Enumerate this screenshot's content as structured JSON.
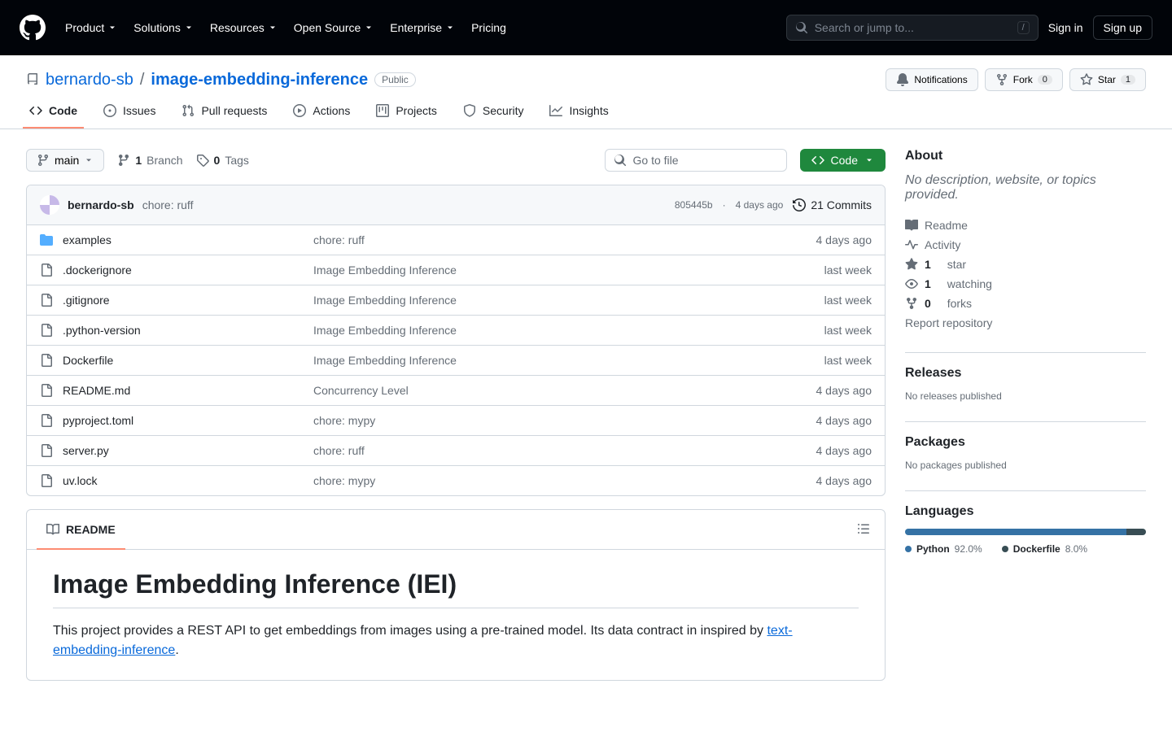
{
  "header": {
    "nav": [
      "Product",
      "Solutions",
      "Resources",
      "Open Source",
      "Enterprise",
      "Pricing"
    ],
    "search_placeholder": "Search or jump to...",
    "sign_in": "Sign in",
    "sign_up": "Sign up"
  },
  "repo": {
    "owner": "bernardo-sb",
    "name": "image-embedding-inference",
    "visibility": "Public",
    "notifications": "Notifications",
    "fork": "Fork",
    "fork_count": "0",
    "star": "Star",
    "star_count": "1"
  },
  "tabs": [
    "Code",
    "Issues",
    "Pull requests",
    "Actions",
    "Projects",
    "Security",
    "Insights"
  ],
  "branch": "main",
  "branches_count": "1",
  "branches_label": "Branch",
  "tags_count": "0",
  "tags_label": "Tags",
  "file_search_placeholder": "Go to file",
  "code_btn": "Code",
  "latest_commit": {
    "author": "bernardo-sb",
    "message": "chore: ruff",
    "sha": "805445b",
    "time": "4 days ago",
    "commits_count": "21 Commits"
  },
  "files": [
    {
      "type": "dir",
      "name": "examples",
      "msg": "chore: ruff",
      "time": "4 days ago"
    },
    {
      "type": "file",
      "name": ".dockerignore",
      "msg": "Image Embedding Inference",
      "time": "last week"
    },
    {
      "type": "file",
      "name": ".gitignore",
      "msg": "Image Embedding Inference",
      "time": "last week"
    },
    {
      "type": "file",
      "name": ".python-version",
      "msg": "Image Embedding Inference",
      "time": "last week"
    },
    {
      "type": "file",
      "name": "Dockerfile",
      "msg": "Image Embedding Inference",
      "time": "last week"
    },
    {
      "type": "file",
      "name": "README.md",
      "msg": "Concurrency Level",
      "time": "4 days ago"
    },
    {
      "type": "file",
      "name": "pyproject.toml",
      "msg": "chore: mypy",
      "time": "4 days ago"
    },
    {
      "type": "file",
      "name": "server.py",
      "msg": "chore: ruff",
      "time": "4 days ago"
    },
    {
      "type": "file",
      "name": "uv.lock",
      "msg": "chore: mypy",
      "time": "4 days ago"
    }
  ],
  "readme": {
    "tab": "README",
    "h1": "Image Embedding Inference (IEI)",
    "p1_before": "This project provides a REST API to get embeddings from images using a pre-trained model. Its data contract in inspired by ",
    "p1_link": "text-embedding-inference",
    "p1_after": "."
  },
  "about": {
    "title": "About",
    "desc": "No description, website, or topics provided.",
    "readme": "Readme",
    "activity": "Activity",
    "stars_n": "1",
    "stars_t": "star",
    "watching_n": "1",
    "watching_t": "watching",
    "forks_n": "0",
    "forks_t": "forks",
    "report": "Report repository"
  },
  "releases": {
    "title": "Releases",
    "empty": "No releases published"
  },
  "packages": {
    "title": "Packages",
    "empty": "No packages published"
  },
  "languages": {
    "title": "Languages",
    "items": [
      {
        "name": "Python",
        "pct": "92.0%",
        "color": "#3572A5"
      },
      {
        "name": "Dockerfile",
        "pct": "8.0%",
        "color": "#384d54"
      }
    ]
  }
}
